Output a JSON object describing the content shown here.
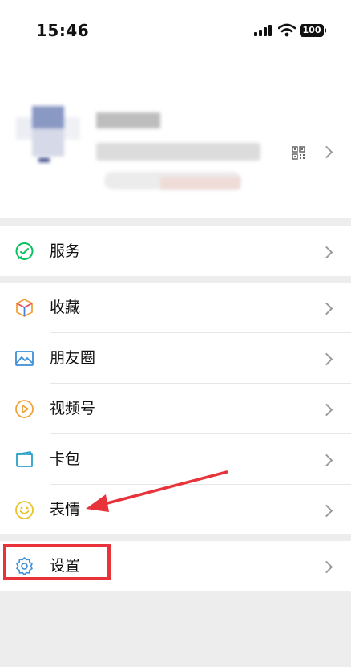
{
  "status_bar": {
    "time": "15:46",
    "battery": "100"
  },
  "colors": {
    "accent_green": "#07c160",
    "highlight": "#e8333b"
  },
  "menu": {
    "services": {
      "label": "服务",
      "icon": "services-icon"
    },
    "favorites": {
      "label": "收藏",
      "icon": "cube-icon"
    },
    "moments": {
      "label": "朋友圈",
      "icon": "image-icon"
    },
    "channels": {
      "label": "视频号",
      "icon": "play-icon"
    },
    "cards": {
      "label": "卡包",
      "icon": "wallet-icon"
    },
    "stickers": {
      "label": "表情",
      "icon": "smiley-icon"
    },
    "settings": {
      "label": "设置",
      "icon": "gear-icon"
    }
  }
}
